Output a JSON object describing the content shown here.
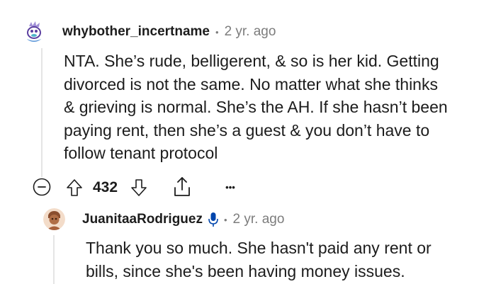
{
  "comment": {
    "username": "whybother_incertname",
    "separator": "•",
    "time": "2 yr. ago",
    "body_lines": [
      "NTA. She’s rude, belligerent, & so is her kid. Getting",
      "divorced is not the same. No matter what she thinks",
      "& grieving is normal. She’s the AH. If she hasn’t been",
      "paying rent, then she’s a guest & you don’t have to",
      "follow tenant protocol"
    ],
    "vote_count": "432",
    "avatar_icon": "snoo-avatar-icon",
    "actions": {
      "collapse_icon": "collapse-minus-icon",
      "upvote_icon": "upvote-arrow-icon",
      "downvote_icon": "downvote-arrow-icon",
      "share_icon": "share-icon",
      "more_icon": "more-options-icon",
      "more_label": "•••"
    }
  },
  "reply": {
    "username": "JuanitaaRodriguez",
    "badge_icon": "microphone-icon",
    "separator": "•",
    "time": "2 yr. ago",
    "body_lines": [
      "Thank you so much. She hasn't paid any rent or",
      "bills, since she's been having money issues."
    ],
    "avatar_icon": "snoo-avatar-icon"
  },
  "colors": {
    "text": "#1c1c1c",
    "meta": "#7c7c7c",
    "thread_line": "#e5e5e5",
    "badge": "#0045ac"
  }
}
